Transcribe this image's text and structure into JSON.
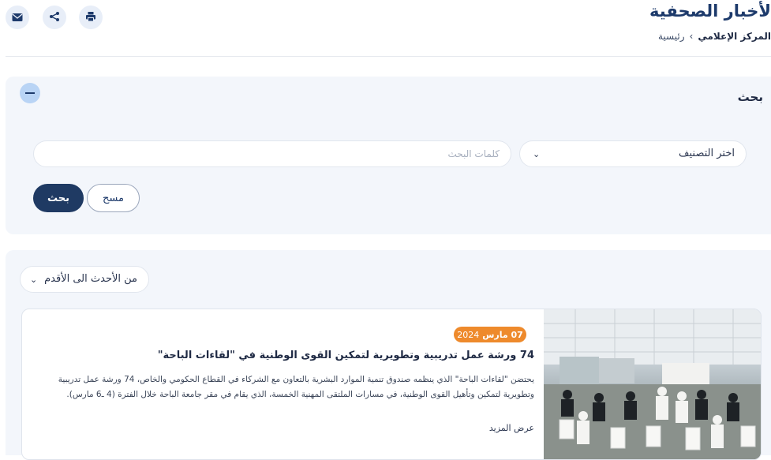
{
  "header": {
    "title": "لأخبار الصحفية",
    "breadcrumb": {
      "home": "رئيسية",
      "separator": "›",
      "current": "المركز الإعلامي"
    },
    "share_icons": [
      "email-icon",
      "share-icon",
      "print-icon"
    ]
  },
  "search_panel": {
    "title": "بحث",
    "category_select": "اختر التصنيف",
    "keywords_placeholder": "كلمات البحث",
    "clear_label": "مسح",
    "search_label": "بحث"
  },
  "results": {
    "sort_select": "من الأحدث الى الأقدم",
    "items": [
      {
        "date_day_month": "07 مارس",
        "date_year": "2024",
        "title": "74 ورشة عمل تدريبية وتطويرية لتمكين القوى الوطنية في \"لقاءات الباحة\"",
        "body": "يحتضن \"لقاءات الباحة\" الذي ينظمه صندوق تنمية الموارد البشرية بالتعاون مع الشركاء في القطاع الحكومي والخاص، 74 ورشة عمل تدريبية وتطويرية لتمكين وتأهيل القوى الوطنية، في مسارات الملتقى المهنية الخمسة، الذي يقام في مقر جامعة الباحة خلال الفترة (4 ـ6 مارس).",
        "more": "عرض المزيد"
      }
    ]
  },
  "colors": {
    "primary": "#1f3a63",
    "accent_badge": "#ee8a2c",
    "panel_bg": "#f3f6fb"
  }
}
